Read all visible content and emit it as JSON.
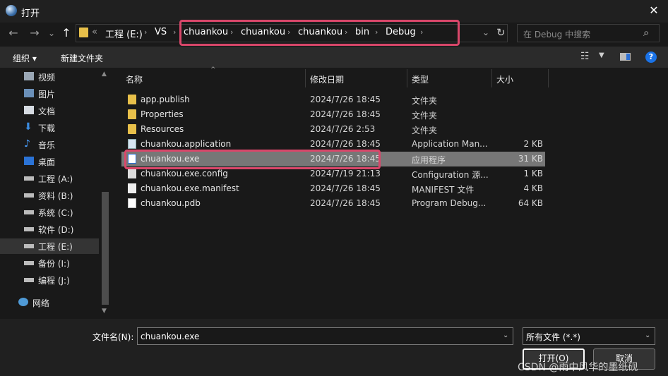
{
  "window": {
    "title": "打开",
    "close": "✕"
  },
  "nav": {
    "back": "←",
    "forward": "→",
    "recent": "⌄",
    "up": "↑",
    "overflow": "«",
    "breadcrumbs": [
      "工程 (E:)",
      "VS",
      "chuankou",
      "chuankou",
      "chuankou",
      "bin",
      "Debug"
    ],
    "separator": "›",
    "search_placeholder": "在 Debug 中搜索"
  },
  "toolbar": {
    "organize": "组织 ▾",
    "new_folder": "新建文件夹"
  },
  "sidebar": {
    "items": [
      {
        "label": "视频",
        "icon": "video-icon"
      },
      {
        "label": "图片",
        "icon": "pictures-icon"
      },
      {
        "label": "文档",
        "icon": "documents-icon"
      },
      {
        "label": "下载",
        "icon": "download-icon"
      },
      {
        "label": "音乐",
        "icon": "music-icon"
      },
      {
        "label": "桌面",
        "icon": "desktop-icon"
      },
      {
        "label": "工程 (A:)",
        "icon": "drive-icon"
      },
      {
        "label": "资料 (B:)",
        "icon": "drive-icon"
      },
      {
        "label": "系统 (C:)",
        "icon": "drive-icon"
      },
      {
        "label": "软件 (D:)",
        "icon": "drive-icon"
      },
      {
        "label": "工程 (E:)",
        "icon": "drive-icon",
        "selected": true
      },
      {
        "label": "备份 (I:)",
        "icon": "drive-icon"
      },
      {
        "label": "编程 (J:)",
        "icon": "drive-icon"
      },
      {
        "label": "网络",
        "icon": "network-icon"
      }
    ]
  },
  "columns": {
    "name": "名称",
    "date": "修改日期",
    "type": "类型",
    "size": "大小"
  },
  "files": [
    {
      "name": "app.publish",
      "date": "2024/7/26 18:45",
      "type": "文件夹",
      "size": "",
      "icon": "folder"
    },
    {
      "name": "Properties",
      "date": "2024/7/26 18:45",
      "type": "文件夹",
      "size": "",
      "icon": "folder"
    },
    {
      "name": "Resources",
      "date": "2024/7/26 2:53",
      "type": "文件夹",
      "size": "",
      "icon": "folder"
    },
    {
      "name": "chuankou.application",
      "date": "2024/7/26 18:45",
      "type": "Application Man...",
      "size": "2 KB",
      "icon": "application"
    },
    {
      "name": "chuankou.exe",
      "date": "2024/7/26 18:45",
      "type": "应用程序",
      "size": "31 KB",
      "icon": "exe",
      "selected": true
    },
    {
      "name": "chuankou.exe.config",
      "date": "2024/7/19 21:13",
      "type": "Configuration 源...",
      "size": "1 KB",
      "icon": "config"
    },
    {
      "name": "chuankou.exe.manifest",
      "date": "2024/7/26 18:45",
      "type": "MANIFEST 文件",
      "size": "4 KB",
      "icon": "document"
    },
    {
      "name": "chuankou.pdb",
      "date": "2024/7/26 18:45",
      "type": "Program Debug...",
      "size": "64 KB",
      "icon": "pdb"
    }
  ],
  "bottom": {
    "filename_label": "文件名(N):",
    "filename_value": "chuankou.exe",
    "filetype_value": "所有文件 (*.*)",
    "open": "打开(O)",
    "cancel": "取消"
  },
  "watermark": "CSDN @雨中风华的墨纸砚",
  "colors": {
    "highlight": "#d9476a",
    "selected_row": "#777777",
    "accent": "#1a73e8"
  }
}
